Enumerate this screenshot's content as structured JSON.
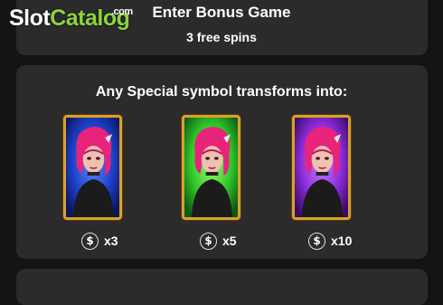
{
  "logo": {
    "part1": "Slot",
    "part2": "Catalog",
    "suffix": ".com"
  },
  "bonus": {
    "title": "Enter Bonus Game",
    "spins": "3 free spins"
  },
  "transform": {
    "heading": "Any Special symbol transforms into:",
    "symbols": [
      {
        "background": "blue",
        "color": "#1f3fd6",
        "multiplier": "x3"
      },
      {
        "background": "green",
        "color": "#2fc42a",
        "multiplier": "x5"
      },
      {
        "background": "purple",
        "color": "#8a2bd8",
        "multiplier": "x10"
      }
    ]
  },
  "icons": {
    "coin": "dollar-coin-icon"
  },
  "colors": {
    "panel": "#2b2b2b",
    "page": "#141414",
    "frame": "#d8a12a",
    "logo_accent": "#8dd43c"
  }
}
